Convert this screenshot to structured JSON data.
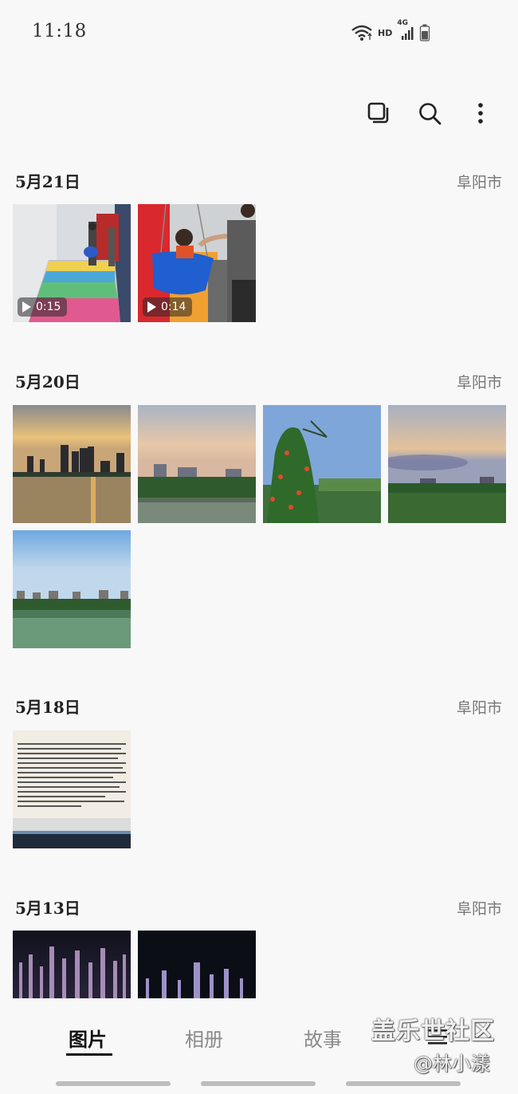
{
  "status": {
    "time": "11:18",
    "hd": "HD",
    "network": "4G"
  },
  "toolbar": {
    "icons": [
      "select-icon",
      "search-icon",
      "more-icon"
    ]
  },
  "sections": [
    {
      "date": "5月21日",
      "location": "阜阳市",
      "items": [
        {
          "type": "video",
          "duration": "0:15"
        },
        {
          "type": "video",
          "duration": "0:14"
        }
      ]
    },
    {
      "date": "5月20日",
      "location": "阜阳市",
      "items": [
        {
          "type": "photo"
        },
        {
          "type": "photo"
        },
        {
          "type": "photo"
        },
        {
          "type": "photo"
        },
        {
          "type": "photo"
        }
      ]
    },
    {
      "date": "5月18日",
      "location": "阜阳市",
      "items": [
        {
          "type": "photo"
        }
      ]
    },
    {
      "date": "5月13日",
      "location": "阜阳市",
      "items": [
        {
          "type": "photo"
        },
        {
          "type": "photo"
        }
      ]
    }
  ],
  "bottom_nav": {
    "tabs": [
      "图片",
      "相册",
      "故事"
    ],
    "active": "图片",
    "menu_icon": "menu-icon"
  },
  "watermark": {
    "brand": "盖乐世社区",
    "user": "@林小漾"
  },
  "colors": {
    "background": "#f8f8f8",
    "text": "#1a1a1a",
    "location": "#777777",
    "nav_inactive": "#8a8a8a"
  }
}
